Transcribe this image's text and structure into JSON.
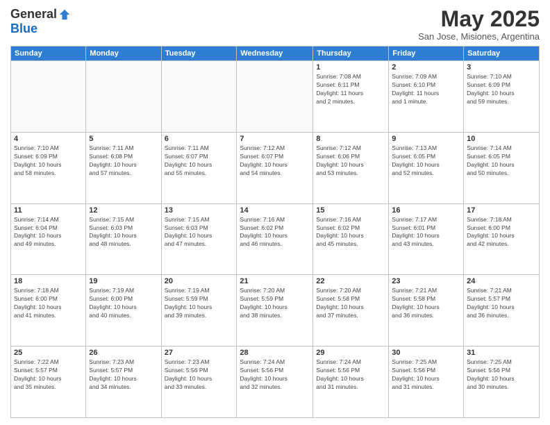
{
  "logo": {
    "general": "General",
    "blue": "Blue"
  },
  "title": "May 2025",
  "location": "San Jose, Misiones, Argentina",
  "days_header": [
    "Sunday",
    "Monday",
    "Tuesday",
    "Wednesday",
    "Thursday",
    "Friday",
    "Saturday"
  ],
  "weeks": [
    [
      {
        "day": "",
        "info": ""
      },
      {
        "day": "",
        "info": ""
      },
      {
        "day": "",
        "info": ""
      },
      {
        "day": "",
        "info": ""
      },
      {
        "day": "1",
        "info": "Sunrise: 7:08 AM\nSunset: 6:11 PM\nDaylight: 11 hours\nand 2 minutes."
      },
      {
        "day": "2",
        "info": "Sunrise: 7:09 AM\nSunset: 6:10 PM\nDaylight: 11 hours\nand 1 minute."
      },
      {
        "day": "3",
        "info": "Sunrise: 7:10 AM\nSunset: 6:09 PM\nDaylight: 10 hours\nand 59 minutes."
      }
    ],
    [
      {
        "day": "4",
        "info": "Sunrise: 7:10 AM\nSunset: 6:09 PM\nDaylight: 10 hours\nand 58 minutes."
      },
      {
        "day": "5",
        "info": "Sunrise: 7:11 AM\nSunset: 6:08 PM\nDaylight: 10 hours\nand 57 minutes."
      },
      {
        "day": "6",
        "info": "Sunrise: 7:11 AM\nSunset: 6:07 PM\nDaylight: 10 hours\nand 55 minutes."
      },
      {
        "day": "7",
        "info": "Sunrise: 7:12 AM\nSunset: 6:07 PM\nDaylight: 10 hours\nand 54 minutes."
      },
      {
        "day": "8",
        "info": "Sunrise: 7:12 AM\nSunset: 6:06 PM\nDaylight: 10 hours\nand 53 minutes."
      },
      {
        "day": "9",
        "info": "Sunrise: 7:13 AM\nSunset: 6:05 PM\nDaylight: 10 hours\nand 52 minutes."
      },
      {
        "day": "10",
        "info": "Sunrise: 7:14 AM\nSunset: 6:05 PM\nDaylight: 10 hours\nand 50 minutes."
      }
    ],
    [
      {
        "day": "11",
        "info": "Sunrise: 7:14 AM\nSunset: 6:04 PM\nDaylight: 10 hours\nand 49 minutes."
      },
      {
        "day": "12",
        "info": "Sunrise: 7:15 AM\nSunset: 6:03 PM\nDaylight: 10 hours\nand 48 minutes."
      },
      {
        "day": "13",
        "info": "Sunrise: 7:15 AM\nSunset: 6:03 PM\nDaylight: 10 hours\nand 47 minutes."
      },
      {
        "day": "14",
        "info": "Sunrise: 7:16 AM\nSunset: 6:02 PM\nDaylight: 10 hours\nand 46 minutes."
      },
      {
        "day": "15",
        "info": "Sunrise: 7:16 AM\nSunset: 6:02 PM\nDaylight: 10 hours\nand 45 minutes."
      },
      {
        "day": "16",
        "info": "Sunrise: 7:17 AM\nSunset: 6:01 PM\nDaylight: 10 hours\nand 43 minutes."
      },
      {
        "day": "17",
        "info": "Sunrise: 7:18 AM\nSunset: 6:00 PM\nDaylight: 10 hours\nand 42 minutes."
      }
    ],
    [
      {
        "day": "18",
        "info": "Sunrise: 7:18 AM\nSunset: 6:00 PM\nDaylight: 10 hours\nand 41 minutes."
      },
      {
        "day": "19",
        "info": "Sunrise: 7:19 AM\nSunset: 6:00 PM\nDaylight: 10 hours\nand 40 minutes."
      },
      {
        "day": "20",
        "info": "Sunrise: 7:19 AM\nSunset: 5:59 PM\nDaylight: 10 hours\nand 39 minutes."
      },
      {
        "day": "21",
        "info": "Sunrise: 7:20 AM\nSunset: 5:59 PM\nDaylight: 10 hours\nand 38 minutes."
      },
      {
        "day": "22",
        "info": "Sunrise: 7:20 AM\nSunset: 5:58 PM\nDaylight: 10 hours\nand 37 minutes."
      },
      {
        "day": "23",
        "info": "Sunrise: 7:21 AM\nSunset: 5:58 PM\nDaylight: 10 hours\nand 36 minutes."
      },
      {
        "day": "24",
        "info": "Sunrise: 7:21 AM\nSunset: 5:57 PM\nDaylight: 10 hours\nand 36 minutes."
      }
    ],
    [
      {
        "day": "25",
        "info": "Sunrise: 7:22 AM\nSunset: 5:57 PM\nDaylight: 10 hours\nand 35 minutes."
      },
      {
        "day": "26",
        "info": "Sunrise: 7:23 AM\nSunset: 5:57 PM\nDaylight: 10 hours\nand 34 minutes."
      },
      {
        "day": "27",
        "info": "Sunrise: 7:23 AM\nSunset: 5:56 PM\nDaylight: 10 hours\nand 33 minutes."
      },
      {
        "day": "28",
        "info": "Sunrise: 7:24 AM\nSunset: 5:56 PM\nDaylight: 10 hours\nand 32 minutes."
      },
      {
        "day": "29",
        "info": "Sunrise: 7:24 AM\nSunset: 5:56 PM\nDaylight: 10 hours\nand 31 minutes."
      },
      {
        "day": "30",
        "info": "Sunrise: 7:25 AM\nSunset: 5:56 PM\nDaylight: 10 hours\nand 31 minutes."
      },
      {
        "day": "31",
        "info": "Sunrise: 7:25 AM\nSunset: 5:56 PM\nDaylight: 10 hours\nand 30 minutes."
      }
    ]
  ]
}
